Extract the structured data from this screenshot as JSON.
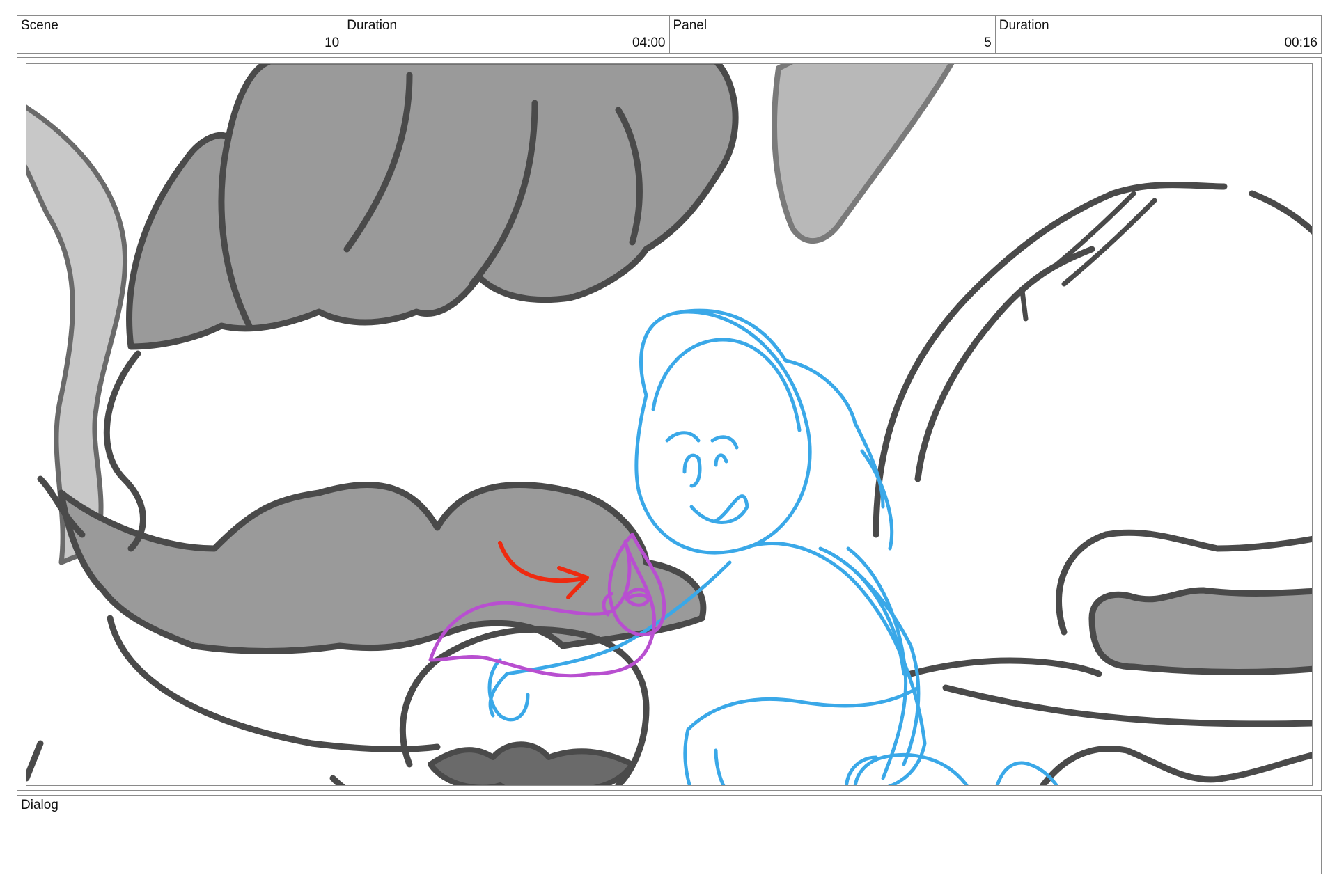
{
  "header": {
    "scene_label": "Scene",
    "scene_value": "10",
    "scene_duration_label": "Duration",
    "scene_duration_value": "04:00",
    "panel_label": "Panel",
    "panel_value": "5",
    "panel_duration_label": "Duration",
    "panel_duration_value": "00:16"
  },
  "dialog": {
    "label": "Dialog",
    "text": ""
  },
  "colors": {
    "frame_border": "#8a8a8a",
    "sketch_dark": "#4a4a4a",
    "sketch_fill": "#9a9a9a",
    "character_blue": "#3aa8e8",
    "creature_purple": "#b84fd0",
    "arrow_red": "#ee2a10"
  }
}
